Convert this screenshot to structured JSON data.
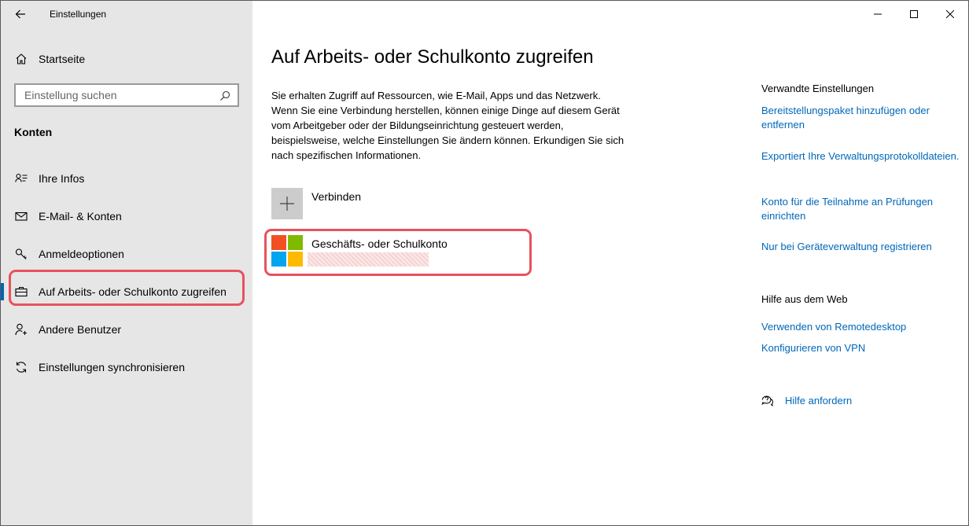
{
  "app": {
    "title": "Einstellungen"
  },
  "sidebar": {
    "home_label": "Startseite",
    "search_placeholder": "Einstellung suchen",
    "section": "Konten",
    "items": [
      {
        "label": "Ihre Infos",
        "icon": "contact-info-icon"
      },
      {
        "label": "E-Mail- & Konten",
        "icon": "mail-icon"
      },
      {
        "label": "Anmeldeoptionen",
        "icon": "key-icon"
      },
      {
        "label": "Auf Arbeits- oder Schulkonto zugreifen",
        "icon": "briefcase-icon",
        "active": true
      },
      {
        "label": "Andere Benutzer",
        "icon": "person-add-icon"
      },
      {
        "label": "Einstellungen synchronisieren",
        "icon": "sync-icon"
      }
    ]
  },
  "main": {
    "title": "Auf Arbeits- oder Schulkonto zugreifen",
    "description": "Sie erhalten Zugriff auf Ressourcen, wie E-Mail, Apps und das Netzwerk. Wenn Sie eine Verbindung herstellen, können einige Dinge auf diesem Gerät vom Arbeitgeber oder der Bildungseinrichtung gesteuert werden, beispielsweise, welche Einstellungen Sie ändern können. Erkundigen Sie sich nach spezifischen Informationen.",
    "connect_label": "Verbinden",
    "account": {
      "title": "Geschäfts- oder Schulkonto"
    }
  },
  "related": {
    "heading": "Verwandte Einstellungen",
    "links": [
      "Bereitstellungspaket hinzufügen oder entfernen",
      "Exportiert Ihre Verwaltungsprotokolldateien.",
      "Konto für die Teilnahme an Prüfungen einrichten",
      "Nur bei Geräteverwaltung registrieren"
    ],
    "web_heading": "Hilfe aus dem Web",
    "web_links": [
      "Verwenden von Remotedesktop",
      "Konfigurieren von VPN"
    ],
    "help_label": "Hilfe anfordern"
  },
  "colors": {
    "accent": "#0063b1",
    "link": "#0067b8",
    "highlight": "#e8525e",
    "sidebar_bg": "#e6e6e6"
  }
}
